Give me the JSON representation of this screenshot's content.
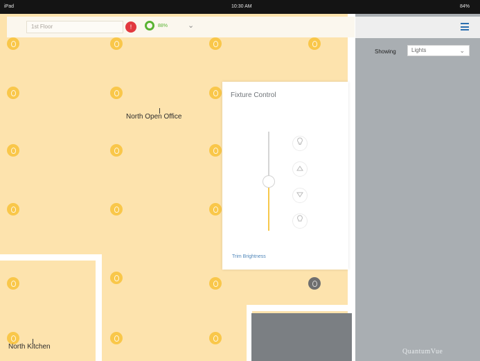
{
  "status_bar": {
    "carrier": "iPad",
    "time": "10:30 AM",
    "battery": "84%"
  },
  "toolbar": {
    "floor_placeholder": "1st Floor",
    "alert_icon": "alert-icon",
    "energy_percent": "88%",
    "chevron": "⌄"
  },
  "side_panel": {
    "menu_icon": "hamburger-icon",
    "showing_label": "Showing",
    "showing_value": "Lights",
    "brand": "QuantumVue"
  },
  "rooms": {
    "north_open_office": "North Open Office",
    "north_kitchen": "North Kitchen"
  },
  "fixture_control": {
    "title": "Fixture Control",
    "brightness_level": 0.5,
    "buttons": [
      "light-on-icon",
      "brightness-up-icon",
      "brightness-down-icon",
      "light-off-icon"
    ],
    "trim_link": "Trim Brightness"
  },
  "colors": {
    "floor": "#fde3ad",
    "light_on": "#f9c74a",
    "light_off": "#6f6f6f",
    "accent_blue": "#2b6fb0",
    "alert_red": "#e2393f",
    "energy_green": "#59b333"
  }
}
